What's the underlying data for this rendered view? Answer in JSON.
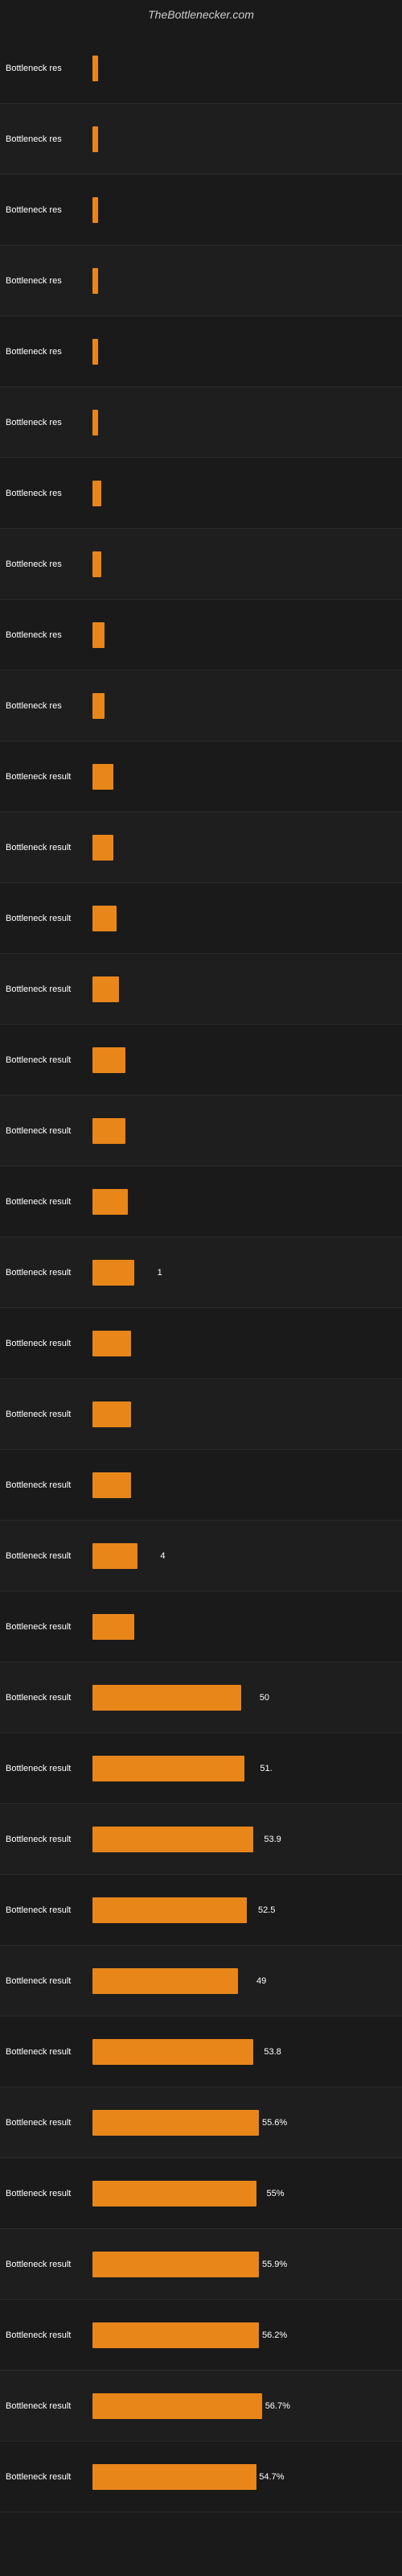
{
  "header": {
    "title": "TheBottlenecker.com"
  },
  "bars": [
    {
      "label": "Bottleneck res",
      "value": null,
      "width_pct": 2
    },
    {
      "label": "Bottleneck res",
      "value": null,
      "width_pct": 2
    },
    {
      "label": "Bottleneck res",
      "value": null,
      "width_pct": 2
    },
    {
      "label": "Bottleneck res",
      "value": null,
      "width_pct": 2
    },
    {
      "label": "Bottleneck res",
      "value": null,
      "width_pct": 2
    },
    {
      "label": "Bottleneck res",
      "value": null,
      "width_pct": 2
    },
    {
      "label": "Bottleneck res",
      "value": null,
      "width_pct": 3
    },
    {
      "label": "Bottleneck res",
      "value": null,
      "width_pct": 3
    },
    {
      "label": "Bottleneck res",
      "value": null,
      "width_pct": 4
    },
    {
      "label": "Bottleneck res",
      "value": null,
      "width_pct": 4
    },
    {
      "label": "Bottleneck result",
      "value": null,
      "width_pct": 7
    },
    {
      "label": "Bottleneck result",
      "value": null,
      "width_pct": 7
    },
    {
      "label": "Bottleneck result",
      "value": null,
      "width_pct": 8
    },
    {
      "label": "Bottleneck result",
      "value": null,
      "width_pct": 9
    },
    {
      "label": "Bottleneck result",
      "value": null,
      "width_pct": 11
    },
    {
      "label": "Bottleneck result",
      "value": null,
      "width_pct": 11
    },
    {
      "label": "Bottleneck result",
      "value": null,
      "width_pct": 12
    },
    {
      "label": "Bottleneck result",
      "value": "1",
      "width_pct": 14
    },
    {
      "label": "Bottleneck result",
      "value": null,
      "width_pct": 13
    },
    {
      "label": "Bottleneck result",
      "value": null,
      "width_pct": 13
    },
    {
      "label": "Bottleneck result",
      "value": null,
      "width_pct": 13
    },
    {
      "label": "Bottleneck result",
      "value": "4",
      "width_pct": 15
    },
    {
      "label": "Bottleneck result",
      "value": null,
      "width_pct": 14
    },
    {
      "label": "Bottleneck result",
      "value": "50",
      "width_pct": 50
    },
    {
      "label": "Bottleneck result",
      "value": "51.",
      "width_pct": 51
    },
    {
      "label": "Bottleneck result",
      "value": "53.9",
      "width_pct": 54
    },
    {
      "label": "Bottleneck result",
      "value": "52.5",
      "width_pct": 52
    },
    {
      "label": "Bottleneck result",
      "value": "49",
      "width_pct": 49
    },
    {
      "label": "Bottleneck result",
      "value": "53.8",
      "width_pct": 54
    },
    {
      "label": "Bottleneck result",
      "value": "55.6%",
      "width_pct": 56
    },
    {
      "label": "Bottleneck result",
      "value": "55%",
      "width_pct": 55
    },
    {
      "label": "Bottleneck result",
      "value": "55.9%",
      "width_pct": 56
    },
    {
      "label": "Bottleneck result",
      "value": "56.2%",
      "width_pct": 56
    },
    {
      "label": "Bottleneck result",
      "value": "56.7%",
      "width_pct": 57
    },
    {
      "label": "Bottleneck result",
      "value": "54.7%",
      "width_pct": 55
    }
  ]
}
